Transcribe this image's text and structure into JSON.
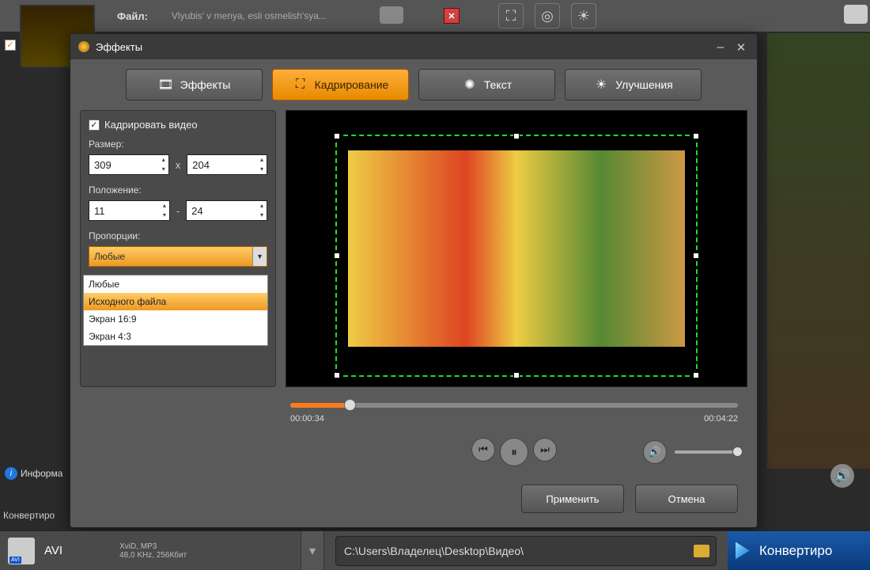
{
  "top": {
    "file_label": "Файл:",
    "file_name": "Vlyubis' v menya, esli osmelish'sya..."
  },
  "modal": {
    "title": "Эффекты",
    "tabs": {
      "effects": "Эффекты",
      "crop": "Кадрирование",
      "text": "Текст",
      "enhance": "Улучшения"
    },
    "crop_checkbox": "Кадрировать видео",
    "size_label": "Размер:",
    "size_w": "309",
    "size_h": "204",
    "size_sep": "x",
    "pos_label": "Положение:",
    "pos_x": "11",
    "pos_y": "24",
    "pos_sep": "-",
    "aspect_label": "Пропорции:",
    "aspect_value": "Любые",
    "aspect_options": [
      "Любые",
      "Исходного файла",
      "Экран 16:9",
      "Экран 4:3"
    ],
    "time_current": "00:00:34",
    "time_total": "00:04:22",
    "apply": "Применить",
    "cancel": "Отмена"
  },
  "sidebar": {
    "info": "Информа",
    "convert": "Конвертиро"
  },
  "bottom": {
    "format_name": "AVI",
    "format_line1": "XviD, MP3",
    "format_line2": "48,0 KHz, 256Кбит",
    "path": "C:\\Users\\Владелец\\Desktop\\Видео\\",
    "convert_btn": "Конвертиро"
  }
}
